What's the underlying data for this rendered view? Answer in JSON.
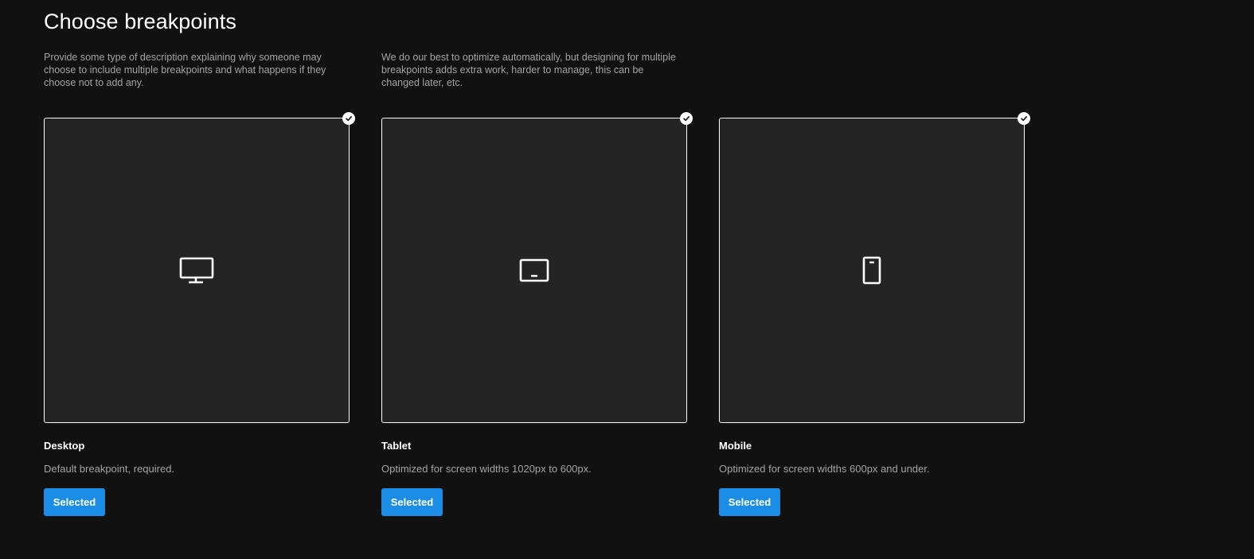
{
  "title": "Choose breakpoints",
  "descriptions": [
    "Provide some type of description explaining why someone may choose to include multiple breakpoints and what happens if they choose not to add any.",
    "We do our best to optimize automatically, but designing for multiple breakpoints adds extra work, harder to manage, this can be changed later, etc."
  ],
  "cards": [
    {
      "name": "Desktop",
      "description": "Default breakpoint, required.",
      "button": "Selected",
      "icon": "desktop-icon",
      "selected": true
    },
    {
      "name": "Tablet",
      "description": "Optimized for screen widths 1020px to 600px.",
      "button": "Selected",
      "icon": "tablet-icon",
      "selected": true
    },
    {
      "name": "Mobile",
      "description": "Optimized for screen widths 600px and under.",
      "button": "Selected",
      "icon": "mobile-icon",
      "selected": true
    }
  ],
  "colors": {
    "background": "#111112",
    "card": "#242424",
    "accent": "#1b8de6",
    "muted_text": "#a3a3a3"
  }
}
